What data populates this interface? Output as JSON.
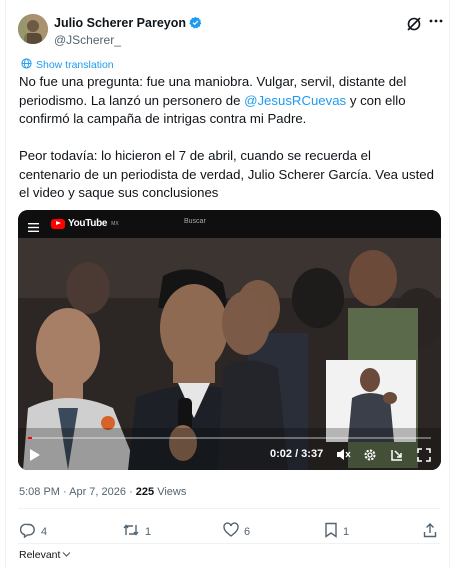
{
  "author": {
    "name": "Julio Scherer Pareyon",
    "handle": "@JScherer_"
  },
  "translate_label": "Show translation",
  "tweet": {
    "line1": "No fue una pregunta: fue una maniobra. Vulgar, servil, distante del periodismo. La lanzó un personero de ",
    "mention": "@JesusRCuevas",
    "line2": " y con ello confirmó la campaña de intrigas contra mi Padre.",
    "paragraph2": "Peor todavía: lo hicieron el 7 de abril, cuando se recuerda el centenario de un periodista de verdad, Julio Scherer García. Vea usted el video y saque sus conclusiones"
  },
  "video": {
    "logo_text": "YouTube",
    "logo_region": "MX",
    "search_placeholder": "Buscar",
    "time": "0:02 / 3:37",
    "progress": 0.01,
    "colors": {
      "progress": "#ff0000"
    }
  },
  "meta": {
    "time": "5:08 PM · Apr 7, 2026 · ",
    "views_count": "225",
    "views_label": " Views"
  },
  "actions": {
    "replies": "4",
    "reposts": "1",
    "likes": "6",
    "bookmarks": "1"
  },
  "sort_label": "Relevant",
  "colors": {
    "accent": "#1d9bf0",
    "muted": "#536471"
  }
}
